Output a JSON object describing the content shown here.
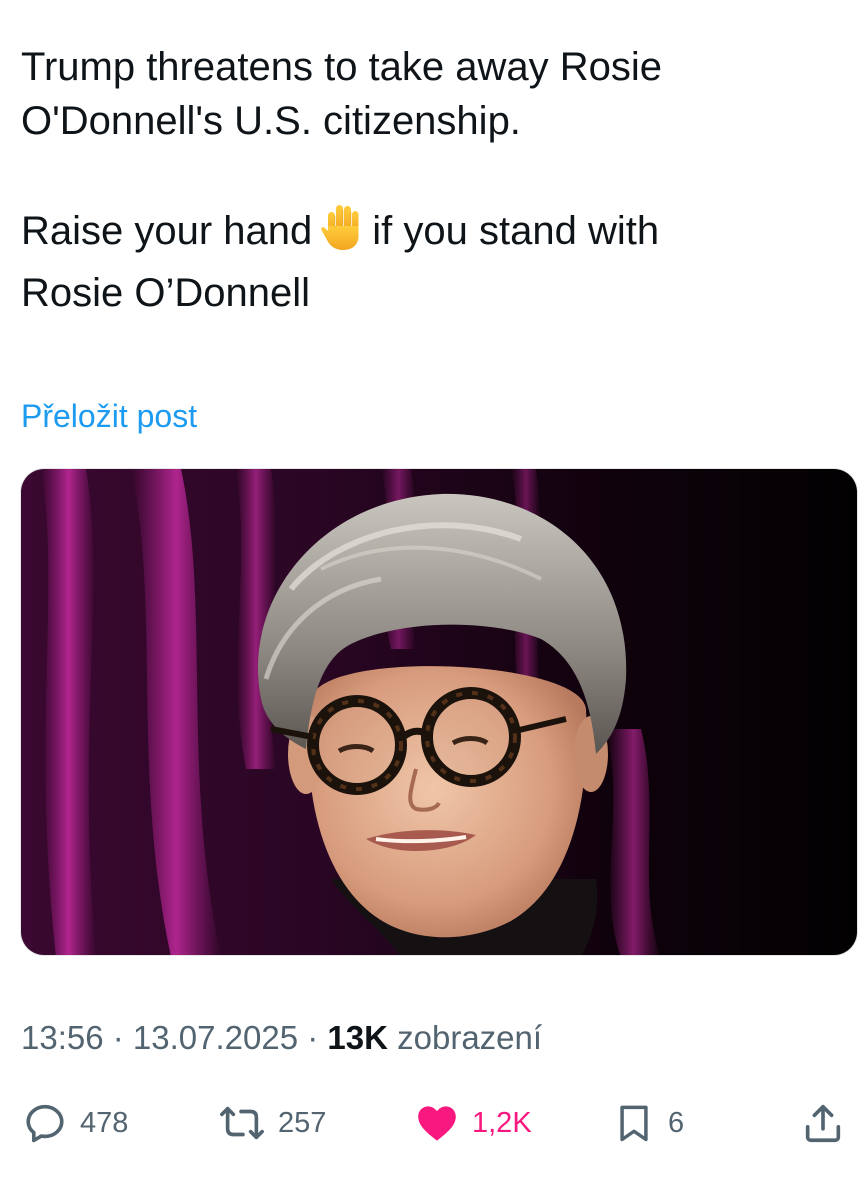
{
  "tweet": {
    "line1": "Trump threatens to take away Rosie",
    "line2": "O'Donnell's U.S. citizenship.",
    "line3_before": "Raise your hand",
    "emoji": "raised-hand-emoji",
    "line3_after": "if you stand with",
    "line4": "Rosie O’Donnell"
  },
  "translate_label": "Přeložit post",
  "media": {
    "alt_icon": "photo"
  },
  "meta": {
    "time": "13:56",
    "separator": " · ",
    "date": "13.07.2025",
    "views_count": "13K",
    "views_label": " zobrazení"
  },
  "actions": {
    "replies": {
      "icon": "reply-icon",
      "count": "478"
    },
    "reposts": {
      "icon": "repost-icon",
      "count": "257"
    },
    "likes": {
      "icon": "heart-icon",
      "count": "1,2K",
      "color": "#f91880"
    },
    "bookmarks": {
      "icon": "bookmark-icon",
      "count": "6"
    },
    "share": {
      "icon": "share-icon"
    }
  },
  "colors": {
    "text": "#0f1419",
    "secondary": "#536471",
    "link": "#1d9bf0",
    "like": "#f91880"
  }
}
